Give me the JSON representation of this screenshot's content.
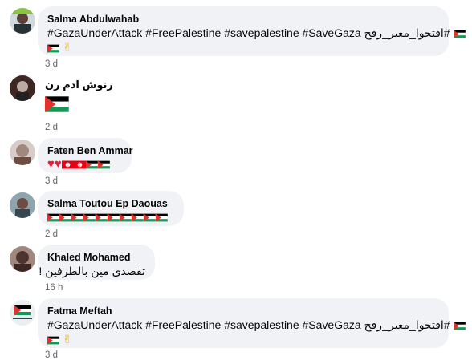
{
  "comments": [
    {
      "author": "Salma Abdulwahab",
      "line1_prefix": "#GazaUnderAttack #FreePalestine #savepalestine #SaveGaza",
      "line1_arabic": "#افتحوا_معبر_رفح",
      "line2": "✌",
      "time": "3 d"
    },
    {
      "author": "رنوش ادم رن",
      "time": "2 d"
    },
    {
      "author": "Faten Ben Ammar",
      "text": "♥♥",
      "time": "3 d"
    },
    {
      "author": "Salma Toutou Ep Daouas",
      "time": "2 d"
    },
    {
      "author": "Khaled Mohamed",
      "text": "تقصدى مين بالطرفين !",
      "time": "16 h"
    },
    {
      "author": "Fatma Meftah",
      "line1_prefix": "#GazaUnderAttack #FreePalestine #savepalestine #SaveGaza",
      "line1_arabic": "#افتحوا_معبر_رفح",
      "line2": "✌",
      "time": "3 d"
    }
  ],
  "colors": {
    "bubble": "#f0f2f5",
    "meta": "#65676b",
    "heart": "#e41e3f"
  }
}
